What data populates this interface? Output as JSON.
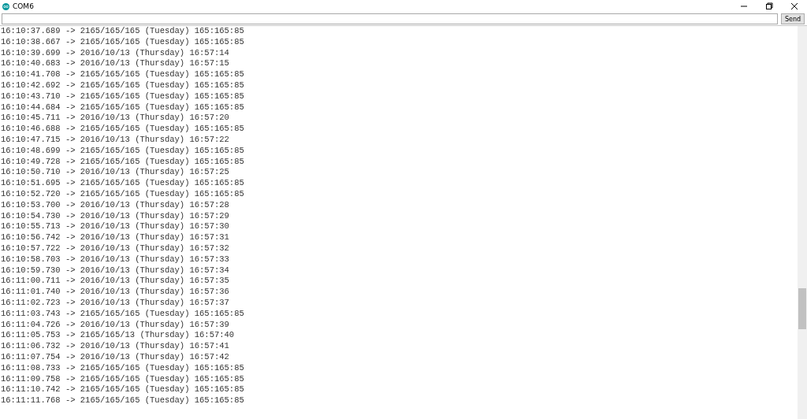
{
  "window": {
    "title": "COM6"
  },
  "send_button": "Send",
  "output_lines": [
    "16:10:37.689 -> 2165/165/165 (Tuesday) 165:165:85",
    "16:10:38.667 -> 2165/165/165 (Tuesday) 165:165:85",
    "16:10:39.699 -> 2016/10/13 (Thursday) 16:57:14",
    "16:10:40.683 -> 2016/10/13 (Thursday) 16:57:15",
    "16:10:41.708 -> 2165/165/165 (Tuesday) 165:165:85",
    "16:10:42.692 -> 2165/165/165 (Tuesday) 165:165:85",
    "16:10:43.710 -> 2165/165/165 (Tuesday) 165:165:85",
    "16:10:44.684 -> 2165/165/165 (Tuesday) 165:165:85",
    "16:10:45.711 -> 2016/10/13 (Thursday) 16:57:20",
    "16:10:46.688 -> 2165/165/165 (Tuesday) 165:165:85",
    "16:10:47.715 -> 2016/10/13 (Thursday) 16:57:22",
    "16:10:48.699 -> 2165/165/165 (Tuesday) 165:165:85",
    "16:10:49.728 -> 2165/165/165 (Tuesday) 165:165:85",
    "16:10:50.710 -> 2016/10/13 (Thursday) 16:57:25",
    "16:10:51.695 -> 2165/165/165 (Tuesday) 165:165:85",
    "16:10:52.720 -> 2165/165/165 (Tuesday) 165:165:85",
    "16:10:53.700 -> 2016/10/13 (Thursday) 16:57:28",
    "16:10:54.730 -> 2016/10/13 (Thursday) 16:57:29",
    "16:10:55.713 -> 2016/10/13 (Thursday) 16:57:30",
    "16:10:56.742 -> 2016/10/13 (Thursday) 16:57:31",
    "16:10:57.722 -> 2016/10/13 (Thursday) 16:57:32",
    "16:10:58.703 -> 2016/10/13 (Thursday) 16:57:33",
    "16:10:59.730 -> 2016/10/13 (Thursday) 16:57:34",
    "16:11:00.711 -> 2016/10/13 (Thursday) 16:57:35",
    "16:11:01.740 -> 2016/10/13 (Thursday) 16:57:36",
    "16:11:02.723 -> 2016/10/13 (Thursday) 16:57:37",
    "16:11:03.743 -> 2165/165/165 (Tuesday) 165:165:85",
    "16:11:04.726 -> 2016/10/13 (Thursday) 16:57:39",
    "16:11:05.753 -> 2165/165/13 (Thursday) 16:57:40",
    "16:11:06.732 -> 2016/10/13 (Thursday) 16:57:41",
    "16:11:07.754 -> 2016/10/13 (Thursday) 16:57:42",
    "16:11:08.733 -> 2165/165/165 (Tuesday) 165:165:85",
    "16:11:09.758 -> 2165/165/165 (Tuesday) 165:165:85",
    "16:11:10.742 -> 2165/165/165 (Tuesday) 165:165:85",
    "16:11:11.768 -> 2165/165/165 (Tuesday) 165:165:85"
  ]
}
